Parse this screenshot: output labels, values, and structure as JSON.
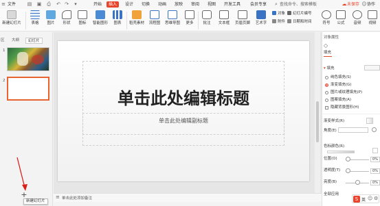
{
  "menu": {
    "file": "文件",
    "items": [
      "开始",
      "插入",
      "设计",
      "切换",
      "动画",
      "放映",
      "审阅",
      "视图",
      "开发工具",
      "会员专享"
    ],
    "search_placeholder": "查找命令、搜索模板",
    "unsynced": "未保存",
    "collab": "协作"
  },
  "ribbon": {
    "new_slide": "新建幻灯片",
    "table": "表格",
    "picture": "图片",
    "shape": "形状",
    "icon": "图标",
    "smart_graphic": "智能图形",
    "chart": "图表",
    "daoke_material": "稻壳素材",
    "flowchart": "流程图",
    "mindmap": "思维导图",
    "more": "更多",
    "comment": "批注",
    "textbox": "文本框",
    "header_footer": "页眉页脚",
    "wordart": "艺术字",
    "symbol": "符号",
    "formula": "公式",
    "audio": "音频",
    "video": "视频",
    "object": "对象",
    "slide_number": "幻灯片编号",
    "attachment": "附件",
    "datetime": "日期和时间"
  },
  "left_panel": {
    "tab_outline_abbr": "区",
    "tab_outline": "大纲",
    "tab_slides": "幻灯片",
    "slide_numbers": [
      "1",
      "2"
    ]
  },
  "slide": {
    "title": "单击此处编辑标题",
    "subtitle": "单击此处编辑副标题"
  },
  "notes": {
    "placeholder": "单击此处添加备注"
  },
  "new_slide_tooltip": "新建幻灯片",
  "right_panel": {
    "header": "对象属性",
    "tab_fill": "填充",
    "section_fill": "填充",
    "options": [
      "纯色填充(S)",
      "渐变填充(G)",
      "图片或纹理填充(P)",
      "图案填充(A)"
    ],
    "selected_option": "渐变填充(G)",
    "hide_bg": "隐藏背景图形(H)",
    "gradient_style": "渐变样式(R)",
    "angle": "角度(E)",
    "stops": "色标颜色(R)",
    "position": "位置(O)",
    "position_value": "0%",
    "transparency": "透明度(T)",
    "transparency_value": "0%",
    "brightness": "亮度(B)",
    "brightness_value": "0%",
    "apply_all": "全部应用"
  },
  "ime": {
    "label": "英"
  },
  "colors": {
    "accent": "#e8432b",
    "selection": "#e8632f"
  }
}
